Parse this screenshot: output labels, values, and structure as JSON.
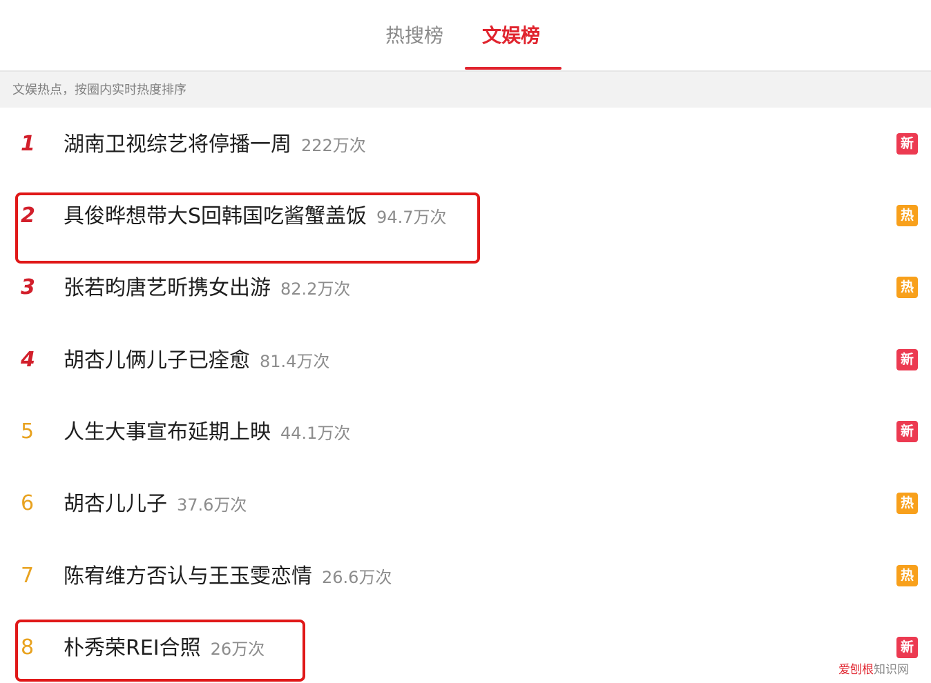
{
  "tabs": [
    {
      "label": "热搜榜",
      "active": false
    },
    {
      "label": "文娱榜",
      "active": true
    }
  ],
  "subtitle": "文娱热点，按圈内实时热度排序",
  "items": [
    {
      "rank": "1",
      "title": "湖南卫视综艺将停播一周",
      "count": "222万次",
      "badge": "新"
    },
    {
      "rank": "2",
      "title": "具俊晔想带大S回韩国吃酱蟹盖饭",
      "count": "94.7万次",
      "badge": "热"
    },
    {
      "rank": "3",
      "title": "张若昀唐艺昕携女出游",
      "count": "82.2万次",
      "badge": "热"
    },
    {
      "rank": "4",
      "title": "胡杏儿俩儿子已痊愈",
      "count": "81.4万次",
      "badge": "新"
    },
    {
      "rank": "5",
      "title": "人生大事宣布延期上映",
      "count": "44.1万次",
      "badge": "新"
    },
    {
      "rank": "6",
      "title": "胡杏儿儿子",
      "count": "37.6万次",
      "badge": "热"
    },
    {
      "rank": "7",
      "title": "陈宥维方否认与王玉雯恋情",
      "count": "26.6万次",
      "badge": "热"
    },
    {
      "rank": "8",
      "title": "朴秀荣REI合照",
      "count": "26万次",
      "badge": "新"
    }
  ],
  "watermark": {
    "part1": "爱刨根",
    "part2": "知识网"
  },
  "colors": {
    "accent": "#e0242e",
    "badge_new": "#ec3a51",
    "badge_hot": "#f8a01b",
    "rank_top": "#d21f2b",
    "rank_normal": "#e8a21f"
  }
}
